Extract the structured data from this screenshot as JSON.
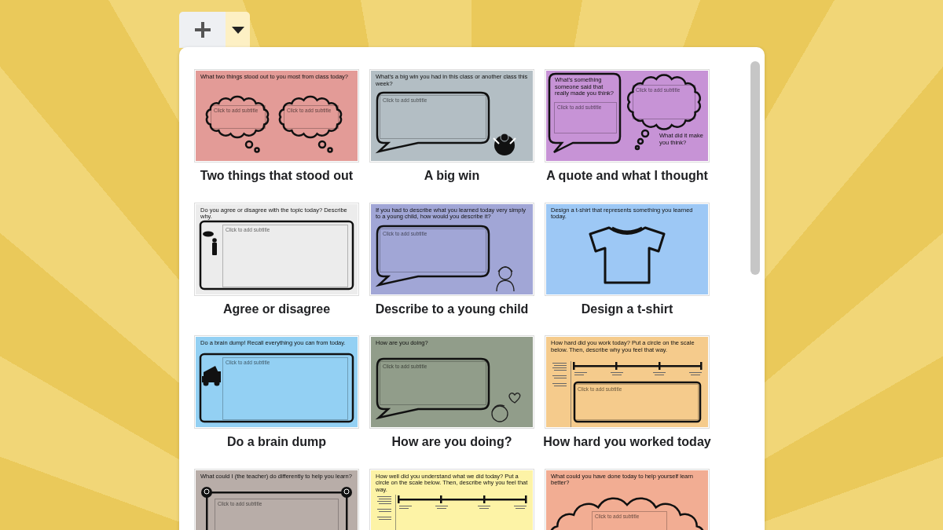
{
  "toolbar": {
    "dropdown_active": true
  },
  "templates": [
    {
      "title": "Two things that stood out",
      "kind": "clouds2",
      "color": "#e39b97",
      "prompt": "What two things stood out to you most from class today?",
      "subtitles": [
        "Click to add subtitle",
        "Click to add subtitle"
      ]
    },
    {
      "title": "A big win",
      "kind": "bubble",
      "color": "#b3bec4",
      "prompt": "What’s a big win you had in this class or another class this week?",
      "subtitles": [
        "Click to add subtitle"
      ]
    },
    {
      "title": "A quote and what I thought",
      "kind": "quote",
      "color": "#c793d6",
      "prompt": "What’s something someone said that really made you think?",
      "second_prompt": "What did it make you think?",
      "subtitles": [
        "Click to add subtitle",
        "Click to add subtitle"
      ]
    },
    {
      "title": "Agree or disagree",
      "kind": "frame",
      "color": "#ececec",
      "prompt": "Do you agree or disagree with the topic today? Describe why.",
      "subtitles": [
        "Click to add subtitle"
      ]
    },
    {
      "title": "Describe to a young child",
      "kind": "bubble",
      "color": "#a1a6d6",
      "prompt": "If you had to describe what you learned today very simply to a young child, how would you describe it?",
      "subtitles": [
        "Click to add subtitle"
      ]
    },
    {
      "title": "Design a t-shirt",
      "kind": "tshirt",
      "color": "#9dc8f5",
      "prompt": "Design a t-shirt that represents something you learned today."
    },
    {
      "title": "Do a brain dump",
      "kind": "frame",
      "color": "#93d0f3",
      "prompt": "Do a brain dump! Recall everything you can from today.",
      "subtitles": [
        "Click to add subtitle"
      ]
    },
    {
      "title": "How are you doing?",
      "kind": "bubble",
      "color": "#919d8a",
      "prompt": "How are you doing?",
      "subtitles": [
        "Click to add subtitle"
      ]
    },
    {
      "title": "How hard you worked today",
      "kind": "scale",
      "color": "#f5cb8c",
      "prompt": "How hard did you work today? Put a circle on the scale below. Then, describe why you feel that way.",
      "subtitles": [
        "Click to add subtitle"
      ]
    },
    {
      "kind": "bulbs",
      "color": "#b8ada8",
      "prompt": "What could I (the teacher) do differently to help you learn?",
      "subtitles": [
        "Click to add subtitle"
      ]
    },
    {
      "kind": "scale",
      "color": "#fdf3a6",
      "prompt": "How well did you understand what we did today? Put a circle on the scale below. Then, describe why you feel that way."
    },
    {
      "kind": "cloud",
      "color": "#f2ad93",
      "prompt": "What could you have done today to help yourself learn better?",
      "subtitles": [
        "Click to add subtitle"
      ]
    }
  ]
}
